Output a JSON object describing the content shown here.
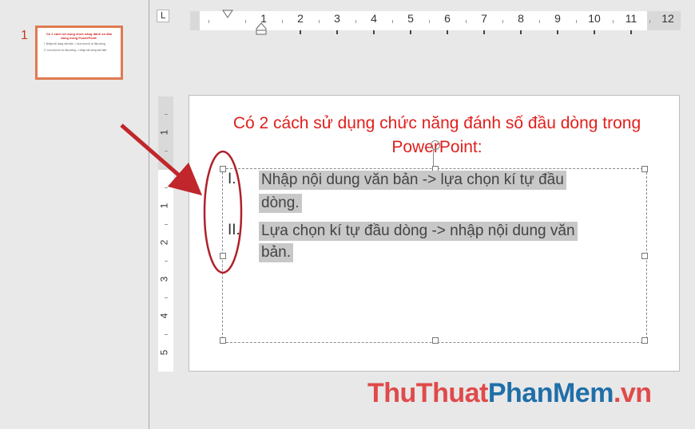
{
  "thumbnail": {
    "slide_number": "1",
    "title": "Có 2 cách sử dụng chức năng đánh số đầu dòng trong PowerPoint:",
    "line1": "I. Nhập nội dung văn bản -> lựa chọn kí tự đầu dòng.",
    "line2": "II. Lựa chọn kí tự đầu dòng -> nhập nội dung văn bản."
  },
  "ruler": {
    "corner_glyph": "L",
    "h_numbers": [
      "1",
      "2",
      "3",
      "4",
      "5",
      "6",
      "7",
      "8",
      "9",
      "10",
      "11",
      "12"
    ],
    "v_numbers": [
      "1",
      "1",
      "2",
      "3",
      "4",
      "5"
    ]
  },
  "slide": {
    "title": "Có 2 cách sử dụng chức năng đánh số đầu dòng trong PowerPoint:",
    "items": [
      {
        "bullet": "I.",
        "lines": [
          "Nhập nội dung văn bản -> lựa chọn kí tự đầu",
          "dòng."
        ]
      },
      {
        "bullet": "II.",
        "lines": [
          "Lựa chọn kí tự đầu dòng -> nhập nội dung văn",
          "bản."
        ]
      }
    ]
  },
  "watermark": {
    "part1": "ThuThuat",
    "part2": "PhanMem",
    "part3": ".vn"
  },
  "colors": {
    "title_red": "#e0201d",
    "annotation_red": "#c0262b",
    "thumb_border": "#e07a50"
  }
}
